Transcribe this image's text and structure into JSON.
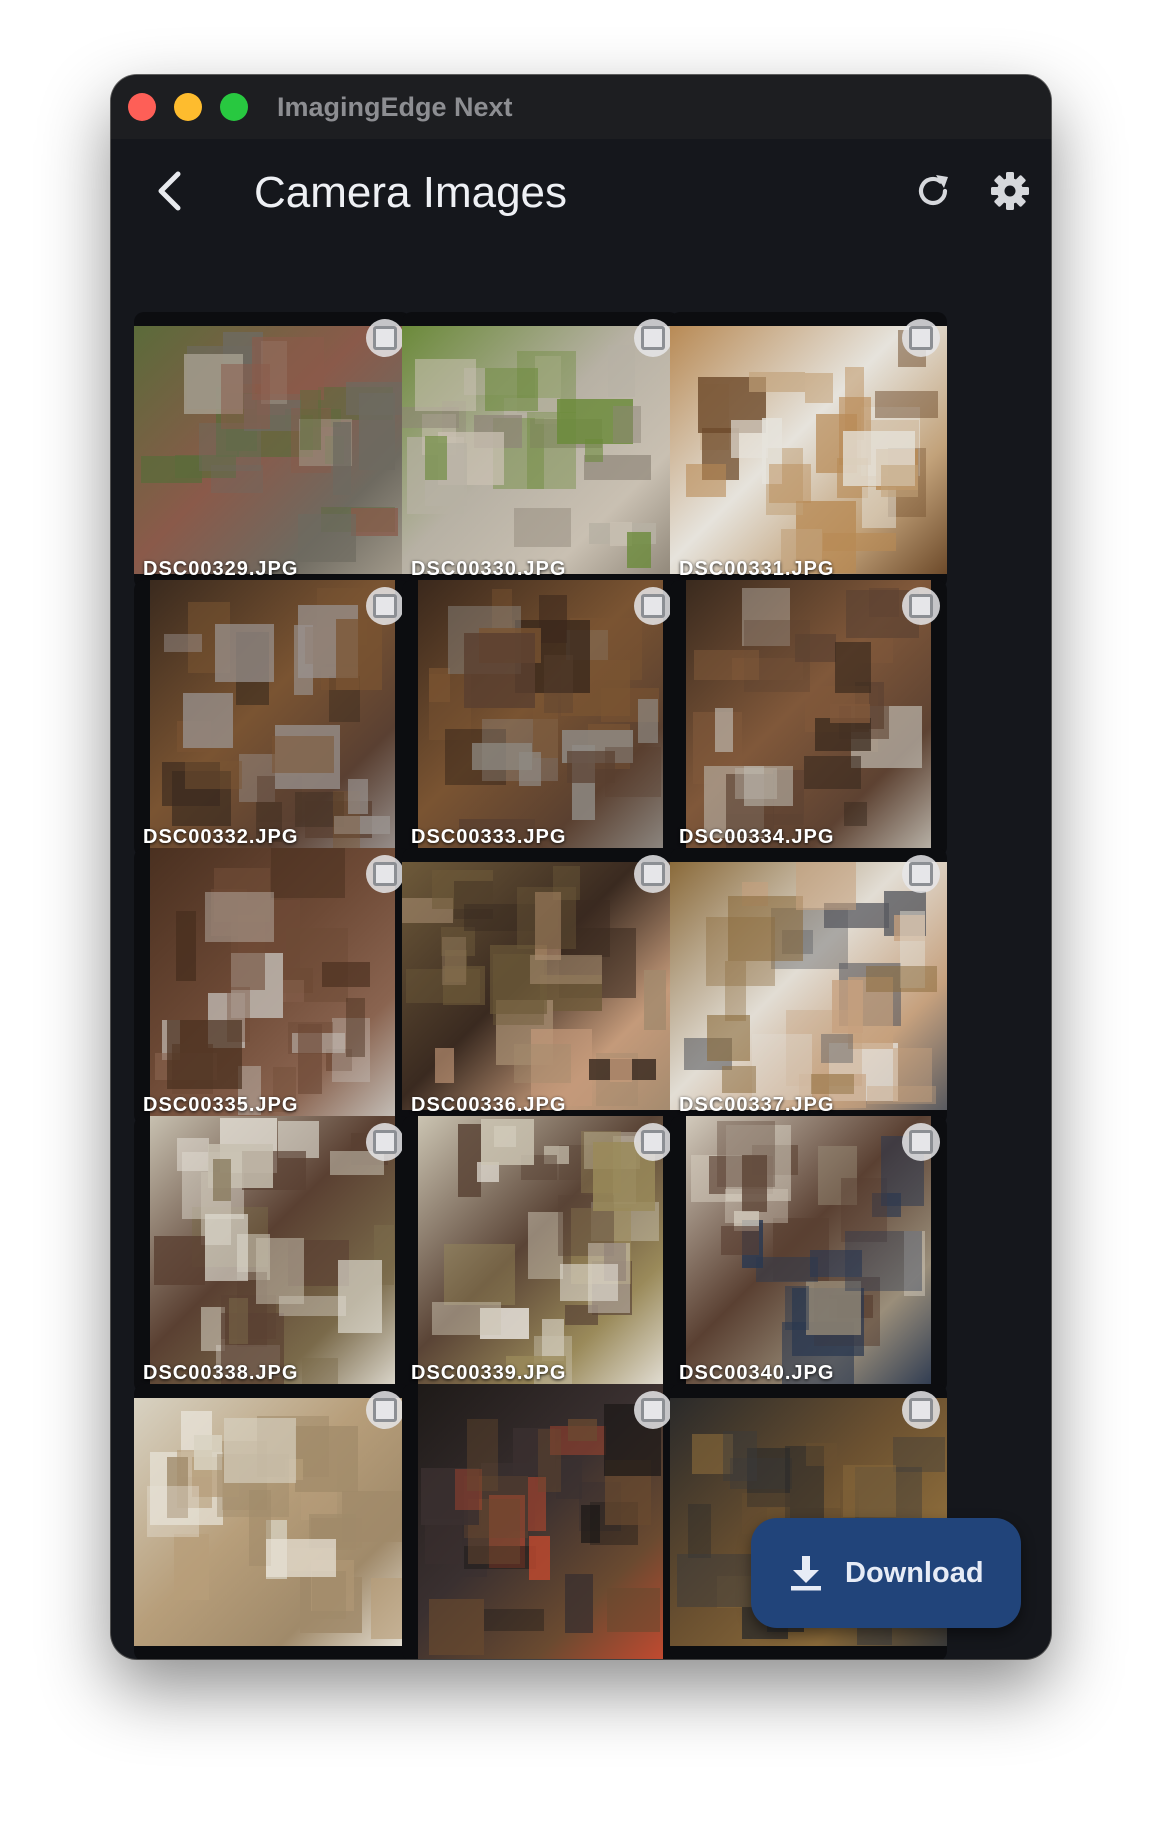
{
  "window": {
    "title": "ImagingEdge Next"
  },
  "appbar": {
    "back_icon": "chevron-left-icon",
    "title": "Camera Images",
    "refresh_icon": "refresh-icon",
    "settings_icon": "gear-icon"
  },
  "images": [
    {
      "filename": "DSC00329.JPG",
      "selected": false,
      "orientation": "landscape",
      "palette": [
        "#5b6b3a",
        "#8a5a4a",
        "#a59d8e",
        "#6e6a60"
      ]
    },
    {
      "filename": "DSC00330.JPG",
      "selected": false,
      "orientation": "landscape",
      "palette": [
        "#6b8a3a",
        "#b7b1a4",
        "#8e8577",
        "#c9c0b2"
      ]
    },
    {
      "filename": "DSC00331.JPG",
      "selected": false,
      "orientation": "landscape",
      "palette": [
        "#b88a55",
        "#e6e3dc",
        "#6d4a2a",
        "#c2a27a"
      ]
    },
    {
      "filename": "DSC00332.JPG",
      "selected": false,
      "orientation": "portrait",
      "palette": [
        "#3a2a1e",
        "#7a5432",
        "#9a9390",
        "#5a4032"
      ]
    },
    {
      "filename": "DSC00333.JPG",
      "selected": false,
      "orientation": "portrait",
      "palette": [
        "#3a281c",
        "#7a5432",
        "#8f8a84",
        "#5a4030"
      ]
    },
    {
      "filename": "DSC00334.JPG",
      "selected": false,
      "orientation": "portrait",
      "palette": [
        "#3a2a1e",
        "#80583a",
        "#bdb8ae",
        "#5d4232"
      ]
    },
    {
      "filename": "DSC00335.JPG",
      "selected": false,
      "orientation": "portrait",
      "palette": [
        "#4a3020",
        "#6e4a36",
        "#c7c3bd",
        "#8a6450"
      ]
    },
    {
      "filename": "DSC00336.JPG",
      "selected": false,
      "orientation": "landscape",
      "palette": [
        "#6e5a3a",
        "#3a2a20",
        "#a38a6e",
        "#c49a7a"
      ]
    },
    {
      "filename": "DSC00337.JPG",
      "selected": false,
      "orientation": "landscape",
      "palette": [
        "#8a6a3a",
        "#e2ddd4",
        "#585a60",
        "#c6a17e"
      ]
    },
    {
      "filename": "DSC00338.JPG",
      "selected": false,
      "orientation": "portrait",
      "palette": [
        "#c7c0b0",
        "#5a4032",
        "#e0dcd2",
        "#7a6a4a"
      ]
    },
    {
      "filename": "DSC00339.JPG",
      "selected": false,
      "orientation": "portrait",
      "palette": [
        "#cbc4b2",
        "#5a4436",
        "#e6e2da",
        "#9a8a5a"
      ]
    },
    {
      "filename": "DSC00340.JPG",
      "selected": false,
      "orientation": "portrait",
      "palette": [
        "#d2cabc",
        "#5a4032",
        "#2a3850",
        "#9a8e7a"
      ]
    },
    {
      "filename": "",
      "selected": false,
      "orientation": "landscape",
      "palette": [
        "#d8d2c2",
        "#b79e7a",
        "#e8e3d8",
        "#a08a6a"
      ]
    },
    {
      "filename": "",
      "selected": false,
      "orientation": "portrait",
      "palette": [
        "#1e1a18",
        "#3a3030",
        "#c24a30",
        "#6a4a30"
      ]
    },
    {
      "filename": "",
      "selected": false,
      "orientation": "landscape",
      "palette": [
        "#2a2a2a",
        "#6a5030",
        "#3a3a3a",
        "#8a6a3a"
      ]
    }
  ],
  "download": {
    "icon": "download-icon",
    "label": "Download"
  },
  "colors": {
    "window_bg": "#15171c",
    "titlebar_bg": "#1d1e21",
    "accent_button": "#21447a",
    "title_text": "#eef0f4"
  }
}
